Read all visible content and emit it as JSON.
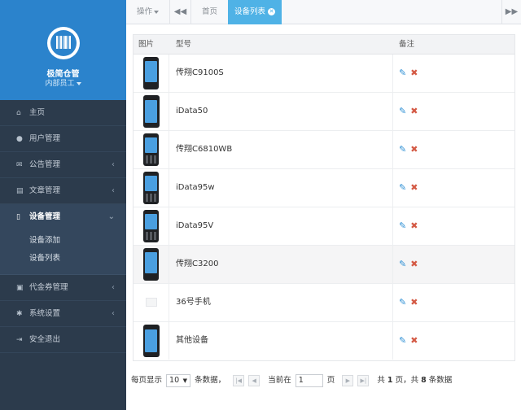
{
  "brand": {
    "name": "极简仓管",
    "role": "内部员工",
    "logo_icon": "barcode-icon",
    "color": "#2b83cc"
  },
  "nav": {
    "items": [
      {
        "icon": "home-icon",
        "glyph": "⌂",
        "label": "主页",
        "chevron": ""
      },
      {
        "icon": "user-icon",
        "glyph": "●",
        "label": "用户管理",
        "chevron": ""
      },
      {
        "icon": "mail-icon",
        "glyph": "✉",
        "label": "公告管理",
        "chevron": "‹"
      },
      {
        "icon": "book-icon",
        "glyph": "▤",
        "label": "文章管理",
        "chevron": "‹"
      },
      {
        "icon": "mobile-icon",
        "glyph": "▯",
        "label": "设备管理",
        "chevron": "⌄"
      },
      {
        "icon": "money-icon",
        "glyph": "▣",
        "label": "代金券管理",
        "chevron": "‹"
      },
      {
        "icon": "gear-icon",
        "glyph": "✱",
        "label": "系统设置",
        "chevron": "‹"
      },
      {
        "icon": "signout-icon",
        "glyph": "⇥",
        "label": "安全退出",
        "chevron": ""
      }
    ],
    "submenu": [
      "设备添加",
      "设备列表"
    ]
  },
  "tabs": {
    "ops": "操作",
    "prev": "◀◀",
    "home": "首页",
    "active": "设备列表",
    "close": "✕",
    "next": "▶▶"
  },
  "table": {
    "headers": {
      "image": "图片",
      "model": "型号",
      "note": "备注"
    },
    "rows": [
      {
        "model": "传翔C9100S",
        "img": "phone"
      },
      {
        "model": "iData50",
        "img": "tablet"
      },
      {
        "model": "传翔C6810WB",
        "img": "keypad"
      },
      {
        "model": "iData95w",
        "img": "keypad"
      },
      {
        "model": "iData95V",
        "img": "keypad"
      },
      {
        "model": "传翔C3200",
        "img": "phone"
      },
      {
        "model": "36号手机",
        "img": "placeholder"
      },
      {
        "model": "其他设备",
        "img": "tablet"
      }
    ],
    "edit_icon": "pencil-icon",
    "delete_icon": "x-icon"
  },
  "pager": {
    "per_page_label": "每页显示",
    "per_page": "10",
    "records_label": "条数据，",
    "current_label": "当前在",
    "current_page": "1",
    "page_label": "页",
    "total_prefix": "共",
    "total_pages": "1",
    "total_mid": "页，共",
    "total_records": "8",
    "total_suffix": "条数据"
  }
}
